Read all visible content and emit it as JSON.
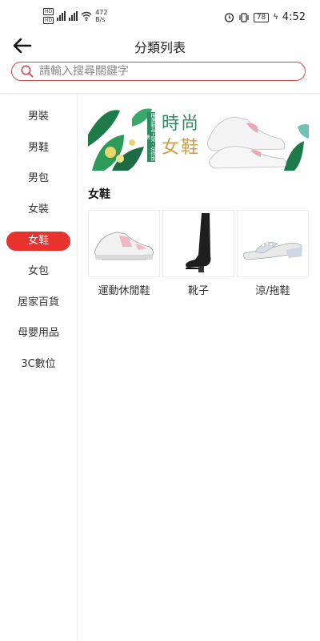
{
  "status_bar": {
    "hd1": "HD",
    "hd2": "HD",
    "net_speed": "472",
    "net_unit": "B/s",
    "battery": "78",
    "time": "4:52"
  },
  "header": {
    "title": "分類列表"
  },
  "search": {
    "placeholder": "請輸入搜尋關鍵字"
  },
  "sidebar": {
    "items": [
      {
        "label": "男裝"
      },
      {
        "label": "男鞋"
      },
      {
        "label": "男包"
      },
      {
        "label": "女裝"
      },
      {
        "label": "女鞋",
        "active": true
      },
      {
        "label": "女包"
      },
      {
        "label": "居家百貨"
      },
      {
        "label": "母嬰用品"
      },
      {
        "label": "3C數位"
      }
    ]
  },
  "banner": {
    "title_line1": "時尚",
    "title_line2": "女鞋",
    "subtitle": "精選新品上架・任你挑選"
  },
  "section": {
    "title": "女鞋"
  },
  "products": [
    {
      "name": "運動休閒鞋",
      "icon": "sneaker-icon"
    },
    {
      "name": "靴子",
      "icon": "boot-icon"
    },
    {
      "name": "涼/拖鞋",
      "icon": "sandal-icon"
    }
  ],
  "colors": {
    "accent": "#e8322e",
    "search_border": "#c94a4a"
  }
}
